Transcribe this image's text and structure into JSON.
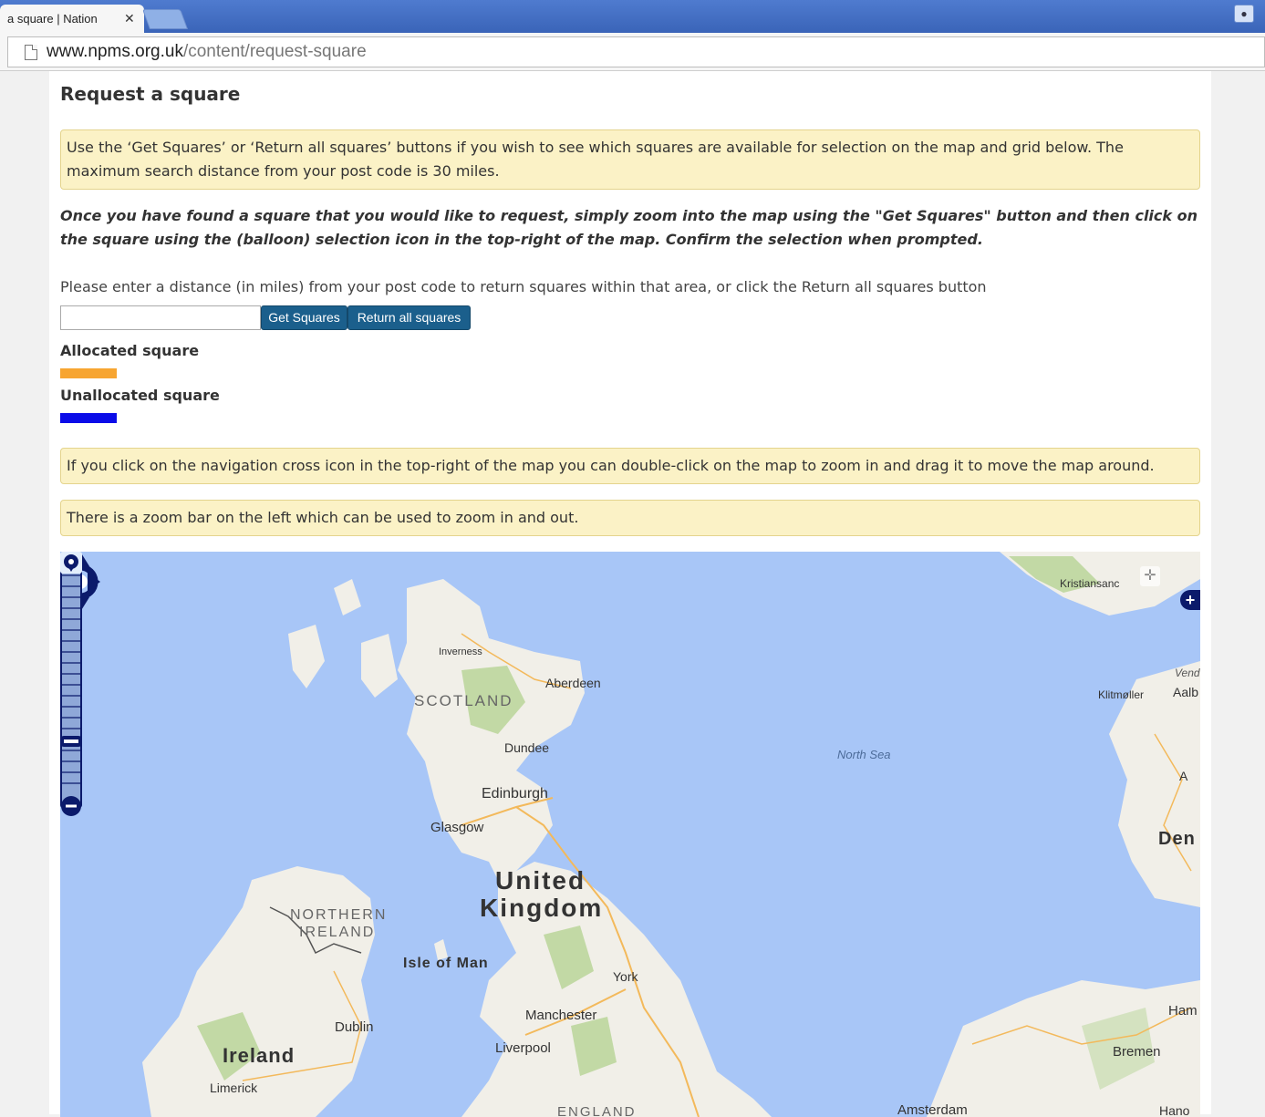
{
  "browser": {
    "tab_title": "a square | Nation",
    "close_glyph": "✕",
    "url_host": "www.npms.org.uk",
    "url_path": "/content/request-square"
  },
  "page": {
    "title": "Request a square",
    "note_get_squares": "Use the ‘Get Squares’ or ‘Return all squares’ buttons if you wish to see which squares are available for selection on the map and grid below. The maximum search distance from your post code is 30 miles.",
    "instruction": "Once you have found a square that you would like to request, simply zoom into the map using the \"Get Squares\" button and then click on the square using the (balloon) selection icon in the top-right of the map. Confirm the selection when prompted.",
    "distance_prompt": "Please enter a distance (in miles) from your post code to return squares within that area, or click the Return all squares button",
    "distance_value": "",
    "get_squares_label": "Get Squares",
    "return_all_label": "Return all squares",
    "legend": [
      {
        "label": "Allocated square",
        "color": "#f7a531"
      },
      {
        "label": "Unallocated square",
        "color": "#0b0ce8"
      }
    ],
    "note_navigation": "If you click on the navigation cross icon in the top-right of the map you can double-click on the map to zoom in and drag it to move the map around.",
    "note_zoom": "There is a zoom bar on the left which can be used to zoom in and out."
  },
  "map": {
    "labels": {
      "kristiansand": "Kristiansanc",
      "inverness": "Inverness",
      "aberdeen": "Aberdeen",
      "scotland": "SCOTLAND",
      "dundee": "Dundee",
      "edinburgh": "Edinburgh",
      "glasgow": "Glasgow",
      "north_sea": "North Sea",
      "klitmoller": "Klitmøller",
      "vend": "Vend",
      "aalb": "Aalb",
      "a": "A",
      "den": "Den",
      "united": "United",
      "kingdom": "Kingdom",
      "northern": "NORTHERN",
      "ireland_region": "IRELAND",
      "isle_of_man": "Isle of Man",
      "york": "York",
      "manchester": "Manchester",
      "liverpool": "Liverpool",
      "dublin": "Dublin",
      "ireland": "Ireland",
      "limerick": "Limerick",
      "england": "ENGLAND",
      "amsterdam": "Amsterdam",
      "bremen": "Bremen",
      "ham": "Ham",
      "hano": "Hano"
    },
    "colors": {
      "sea": "#a8c6f7",
      "land": "#f1efe8",
      "park": "#c2d9a5",
      "road": "#f3b95b",
      "control": "#0b1a6b"
    }
  }
}
